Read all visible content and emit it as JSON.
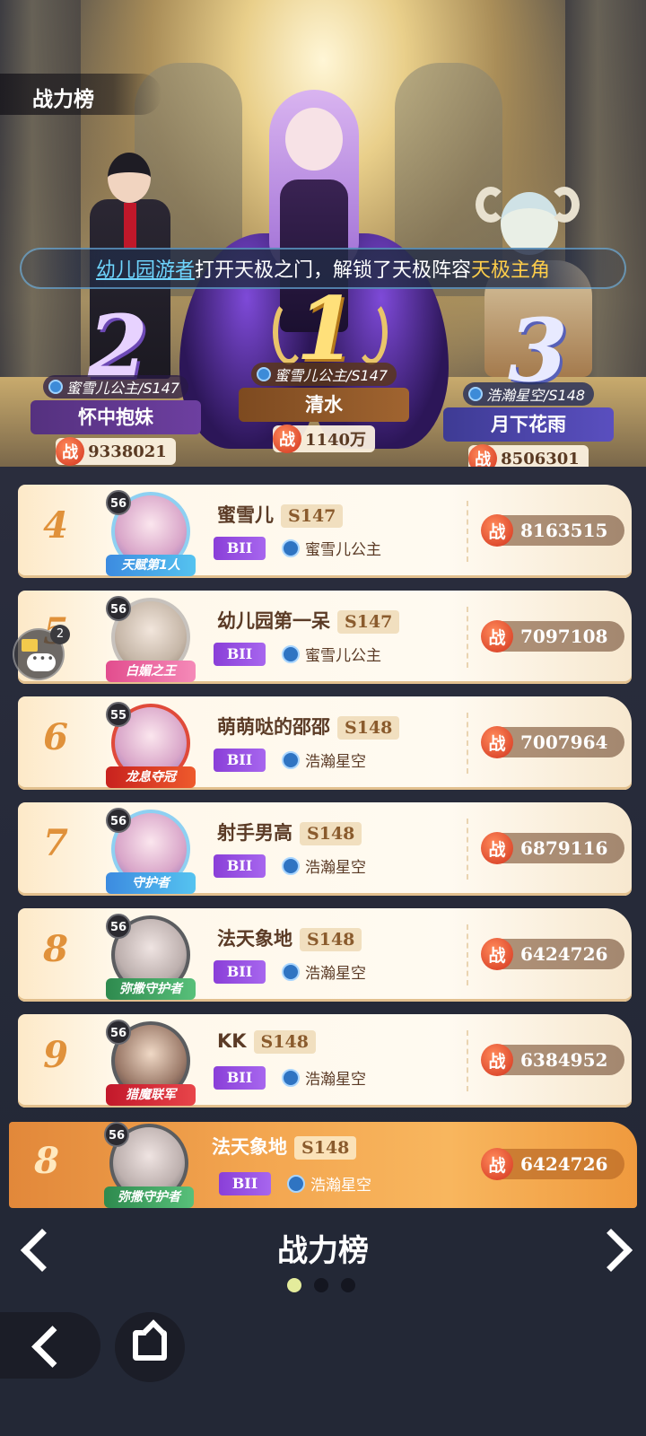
{
  "header": {
    "tab_label": "战力榜"
  },
  "banner": {
    "player": "幼儿园游者",
    "text": "打开天极之门，解锁了天极阵容",
    "unlock": "天极主角"
  },
  "podium": {
    "first": {
      "rank": "1",
      "server": "蜜雪儿公主/S147",
      "name": "清水",
      "power": "1140万"
    },
    "second": {
      "rank": "2",
      "server": "蜜雪儿公主/S147",
      "name": "怀中抱妹",
      "power": "9338021"
    },
    "third": {
      "rank": "3",
      "server": "浩瀚星空/S148",
      "name": "月下花雨",
      "power": "8506301"
    }
  },
  "power_glyph": "战",
  "rows": [
    {
      "rank": "4",
      "level": "56",
      "title": "天赋第1人",
      "name": "蜜雪儿",
      "server": "S147",
      "tier": "BII",
      "guild": "蜜雪儿公主",
      "power": "8163515"
    },
    {
      "rank": "5",
      "level": "56",
      "title": "白媚之王",
      "name": "幼儿园第一呆",
      "server": "S147",
      "tier": "BII",
      "guild": "蜜雪儿公主",
      "power": "7097108"
    },
    {
      "rank": "6",
      "level": "55",
      "title": "龙息夺冠",
      "name": "萌萌哒的邵邵",
      "server": "S148",
      "tier": "BII",
      "guild": "浩瀚星空",
      "power": "7007964"
    },
    {
      "rank": "7",
      "level": "56",
      "title": "守护者",
      "name": "射手男高",
      "server": "S148",
      "tier": "BII",
      "guild": "浩瀚星空",
      "power": "6879116"
    },
    {
      "rank": "8",
      "level": "56",
      "title": "弥撒守护者",
      "name": "法天象地",
      "server": "S148",
      "tier": "BII",
      "guild": "浩瀚星空",
      "power": "6424726"
    },
    {
      "rank": "9",
      "level": "56",
      "title": "猎魔联军",
      "name": "KK",
      "server": "S148",
      "tier": "BII",
      "guild": "浩瀚星空",
      "power": "6384952"
    }
  ],
  "my_rank": {
    "rank": "8",
    "level": "56",
    "title": "弥撒守护者",
    "name": "法天象地",
    "server": "S148",
    "tier": "BII",
    "guild": "浩瀚星空",
    "power": "6424726"
  },
  "chat": {
    "badge": "2"
  },
  "footer": {
    "title": "战力榜",
    "page_count": 3,
    "active_page": 1
  },
  "colors": {
    "accent_orange": "#e0913a",
    "power_red": "#d2331e",
    "tier_purple": "#8a3fd8",
    "banner_cyan": "#6fd6ff",
    "banner_gold": "#ffce4a"
  },
  "icons": {
    "prev": "chevron-left-icon",
    "next": "chevron-right-icon",
    "back": "back-arrow-icon",
    "home": "home-icon",
    "chat": "chat-bubble-icon"
  }
}
